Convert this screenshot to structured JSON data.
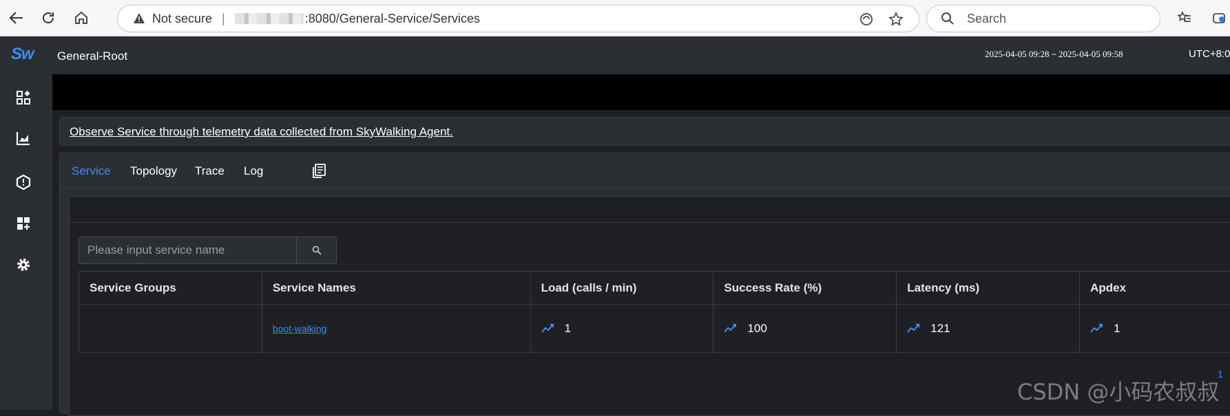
{
  "browser": {
    "security_label": "Not secure",
    "url_text": ":8080/General-Service/Services",
    "search_placeholder": "Search"
  },
  "app": {
    "page_title": "General-Root",
    "time_range": "2025-04-05 09:28 ~ 2025-04-05 09:58",
    "timezone": "UTC+8:0",
    "description": "Observe Service through telemetry data collected from SkyWalking Agent.",
    "accent_color": "#3d8ef0"
  },
  "sidebar": {
    "logo": "Sw",
    "icons": [
      "dashboard-icon",
      "chart-icon",
      "alarm-shield-icon",
      "add-widget-icon",
      "settings-gear-icon"
    ]
  },
  "tabs": [
    {
      "label": "Service",
      "active": true
    },
    {
      "label": "Topology",
      "active": false
    },
    {
      "label": "Trace",
      "active": false
    },
    {
      "label": "Log",
      "active": false
    }
  ],
  "search": {
    "placeholder": "Please input service name"
  },
  "table": {
    "headers": [
      "Service Groups",
      "Service Names",
      "Load (calls / min)",
      "Success Rate (%)",
      "Latency (ms)",
      "Apdex"
    ],
    "rows": [
      {
        "group": "",
        "name": "boot-walking",
        "load": "1",
        "success_rate": "100",
        "latency": "121",
        "apdex": "1"
      }
    ]
  },
  "pagination": {
    "current_page": "1"
  },
  "watermark": "CSDN @小码农叔叔"
}
